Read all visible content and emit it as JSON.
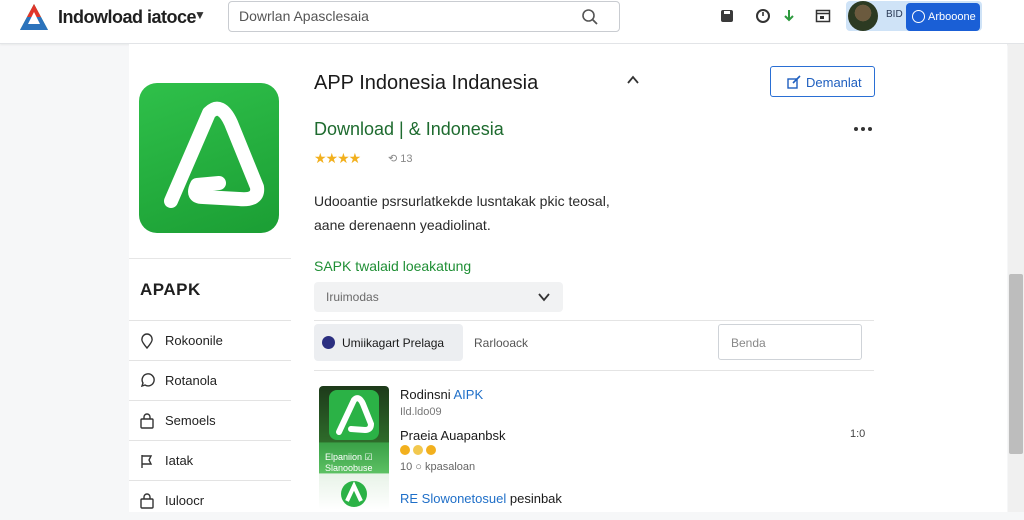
{
  "header": {
    "site_title": "Indowload iatoce",
    "search_placeholder": "Dowrlan Apasclesaia",
    "avatar_lang": "BID",
    "account_label": "Arbooone"
  },
  "app": {
    "title": "APP Indonesia Indanesia",
    "download_label": "Demanlat",
    "developer": "Download | & Indonesia",
    "stars": "★★★★",
    "rating_count": "⟲ 13",
    "description": "Udooantie psrsurlatkekde lusntakak pkic teosal, aane derenaenn yeadiolinat."
  },
  "sidebar": {
    "brand": "APAPK",
    "items": [
      {
        "label": "Rokoonile",
        "icon": "pin-icon"
      },
      {
        "label": "Rotanola",
        "icon": "chat-icon"
      },
      {
        "label": "Semoels",
        "icon": "bag-icon"
      },
      {
        "label": "Iatak",
        "icon": "flag-icon"
      },
      {
        "label": "Iuloocr",
        "icon": "bag-icon"
      }
    ]
  },
  "versions": {
    "section_title": "SAPK twalaid loeakatung",
    "select_value": "Iruimodas"
  },
  "tabs": {
    "active_label": "Umiikagart Prelaga",
    "second_label": "Rarlooack",
    "filter_placeholder": "Benda"
  },
  "list_item": {
    "title_prefix": "Rodinsni",
    "title_accent": "AIPK",
    "subtitle": "Ild.ldo09",
    "name": "Praeia Auapanbsk",
    "count": "1:0",
    "size": "10 ○ kpasaloan",
    "footer_accent": "RE Slowonetosuel",
    "footer_rest": "pesinbak",
    "thumb_caption": "Elpaniion ☑ Slanoobuse"
  }
}
